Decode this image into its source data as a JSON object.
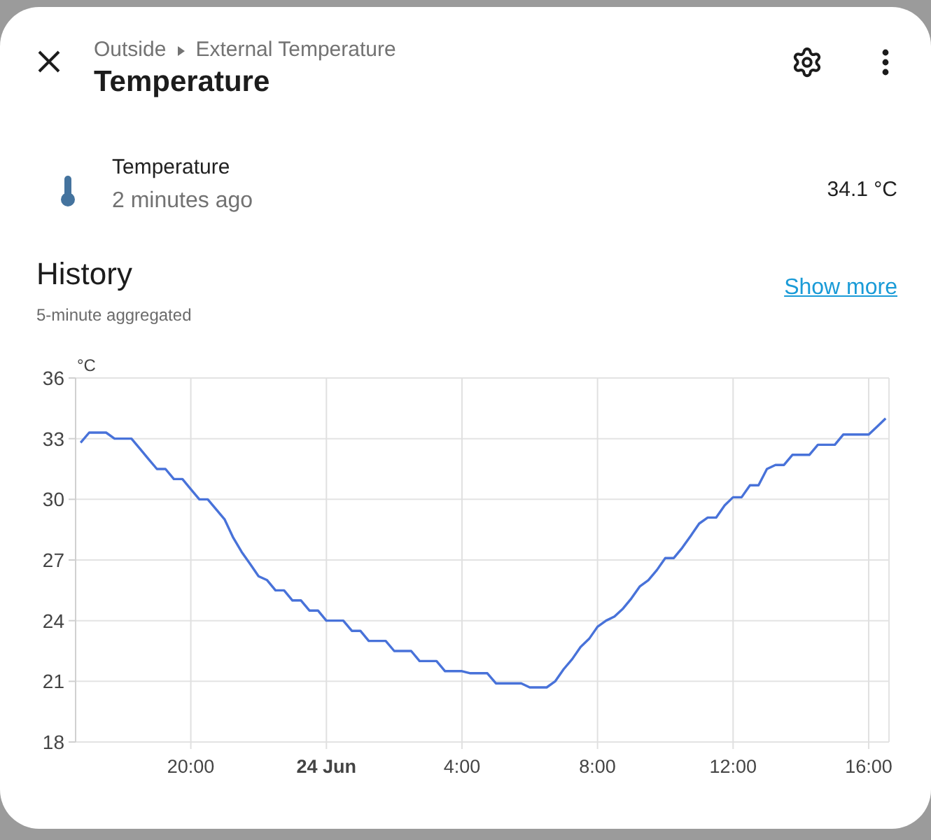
{
  "header": {
    "breadcrumb": [
      "Outside",
      "External Temperature"
    ],
    "title": "Temperature"
  },
  "entity": {
    "name": "Temperature",
    "last_changed": "2 minutes ago",
    "state": "34.1 °C"
  },
  "history": {
    "title": "History",
    "subtitle": "5-minute aggregated",
    "link": "Show more",
    "chart_data": {
      "type": "line",
      "ylabel": "°C",
      "grid": true,
      "ylim": [
        18,
        36
      ],
      "yticks": [
        18,
        21,
        24,
        27,
        30,
        33,
        36
      ],
      "categories": [
        null,
        null,
        null,
        null,
        null,
        null,
        null,
        null,
        null,
        null,
        null,
        null,
        null,
        "20:00",
        null,
        null,
        null,
        null,
        null,
        null,
        null,
        null,
        null,
        null,
        null,
        null,
        null,
        null,
        null,
        "24 Jun",
        null,
        null,
        null,
        null,
        null,
        null,
        null,
        null,
        null,
        null,
        null,
        null,
        null,
        null,
        null,
        "4:00",
        null,
        null,
        null,
        null,
        null,
        null,
        null,
        null,
        null,
        null,
        null,
        null,
        null,
        null,
        null,
        "8:00",
        null,
        null,
        null,
        null,
        null,
        null,
        null,
        null,
        null,
        null,
        null,
        null,
        null,
        null,
        null,
        "12:00",
        null,
        null,
        null,
        null,
        null,
        null,
        null,
        null,
        null,
        null,
        null,
        null,
        null,
        null,
        null,
        "16:00",
        null,
        null
      ],
      "series": [
        {
          "color": "#4872d9",
          "values": [
            32.8,
            33.3,
            33.3,
            33.3,
            33.0,
            33.0,
            33.0,
            32.5,
            32.0,
            31.5,
            31.5,
            31.0,
            31.0,
            30.5,
            30.0,
            30.0,
            29.5,
            29.0,
            28.1,
            27.4,
            26.8,
            26.2,
            26.0,
            25.5,
            25.5,
            25.0,
            25.0,
            24.5,
            24.5,
            24.0,
            24.0,
            24.0,
            23.5,
            23.5,
            23.0,
            23.0,
            23.0,
            22.5,
            22.5,
            22.5,
            22.0,
            22.0,
            22.0,
            21.5,
            21.5,
            21.5,
            21.4,
            21.4,
            21.4,
            20.9,
            20.9,
            20.9,
            20.9,
            20.7,
            20.7,
            20.7,
            21.0,
            21.6,
            22.1,
            22.7,
            23.1,
            23.7,
            24.0,
            24.2,
            24.6,
            25.1,
            25.7,
            26.0,
            26.5,
            27.1,
            27.1,
            27.6,
            28.2,
            28.8,
            29.1,
            29.1,
            29.7,
            30.1,
            30.1,
            30.7,
            30.7,
            31.5,
            31.7,
            31.7,
            32.2,
            32.2,
            32.2,
            32.7,
            32.7,
            32.7,
            33.2,
            33.2,
            33.2,
            33.2,
            33.6,
            34.0
          ]
        }
      ]
    }
  }
}
